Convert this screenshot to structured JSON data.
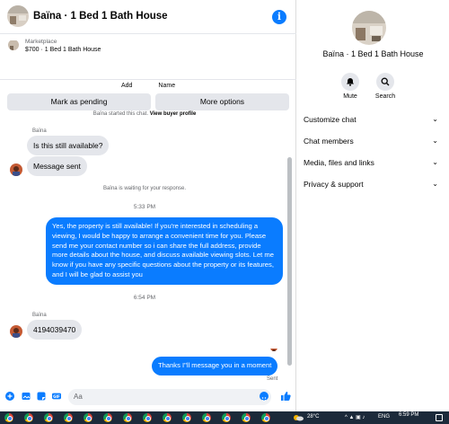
{
  "header": {
    "title": "Baïna · 1 Bed 1 Bath House"
  },
  "listing": {
    "marketplace": "Marketplace",
    "price_title": "$700 · 1 Bed 1 Bath House",
    "mark_pending": "Mark as pending",
    "more_options": "More options"
  },
  "thread": {
    "add_label": "Add",
    "name_label": "Name",
    "started": "Baïna started this chat.",
    "view_profile": "View buyer profile",
    "sender1": "Baïna",
    "msg1": "Is this still available?",
    "msg2": "Message sent",
    "waiting": "Baïna is waiting for your response.",
    "time1": "5:33 PM",
    "reply": "Yes, the property is still available! If you're interested in scheduling a viewing, I would be happy to arrange a convenient time for you. Please send me your contact number so i can share the full address, provide more details about the house, and discuss available viewing slots. Let me know if you have any specific questions about the property or its features, and I will be glad to assist you",
    "time2": "6:54 PM",
    "sender2": "Baïna",
    "msg3": "4194039470",
    "msg4": "Thanks I\"ll message you in a moment",
    "sent": "Sent"
  },
  "composer": {
    "placeholder": "Aa"
  },
  "side": {
    "name": "Baïna · 1 Bed 1 Bath House",
    "mute": "Mute",
    "search": "Search",
    "menu": [
      "Customize chat",
      "Chat members",
      "Media, files and links",
      "Privacy & support"
    ]
  },
  "taskbar": {
    "temp": "28°C",
    "lang": "ENG",
    "time": "6:59 PM"
  },
  "colors": {
    "accent": "#0a7cff",
    "bubble_in": "#e4e6eb"
  }
}
